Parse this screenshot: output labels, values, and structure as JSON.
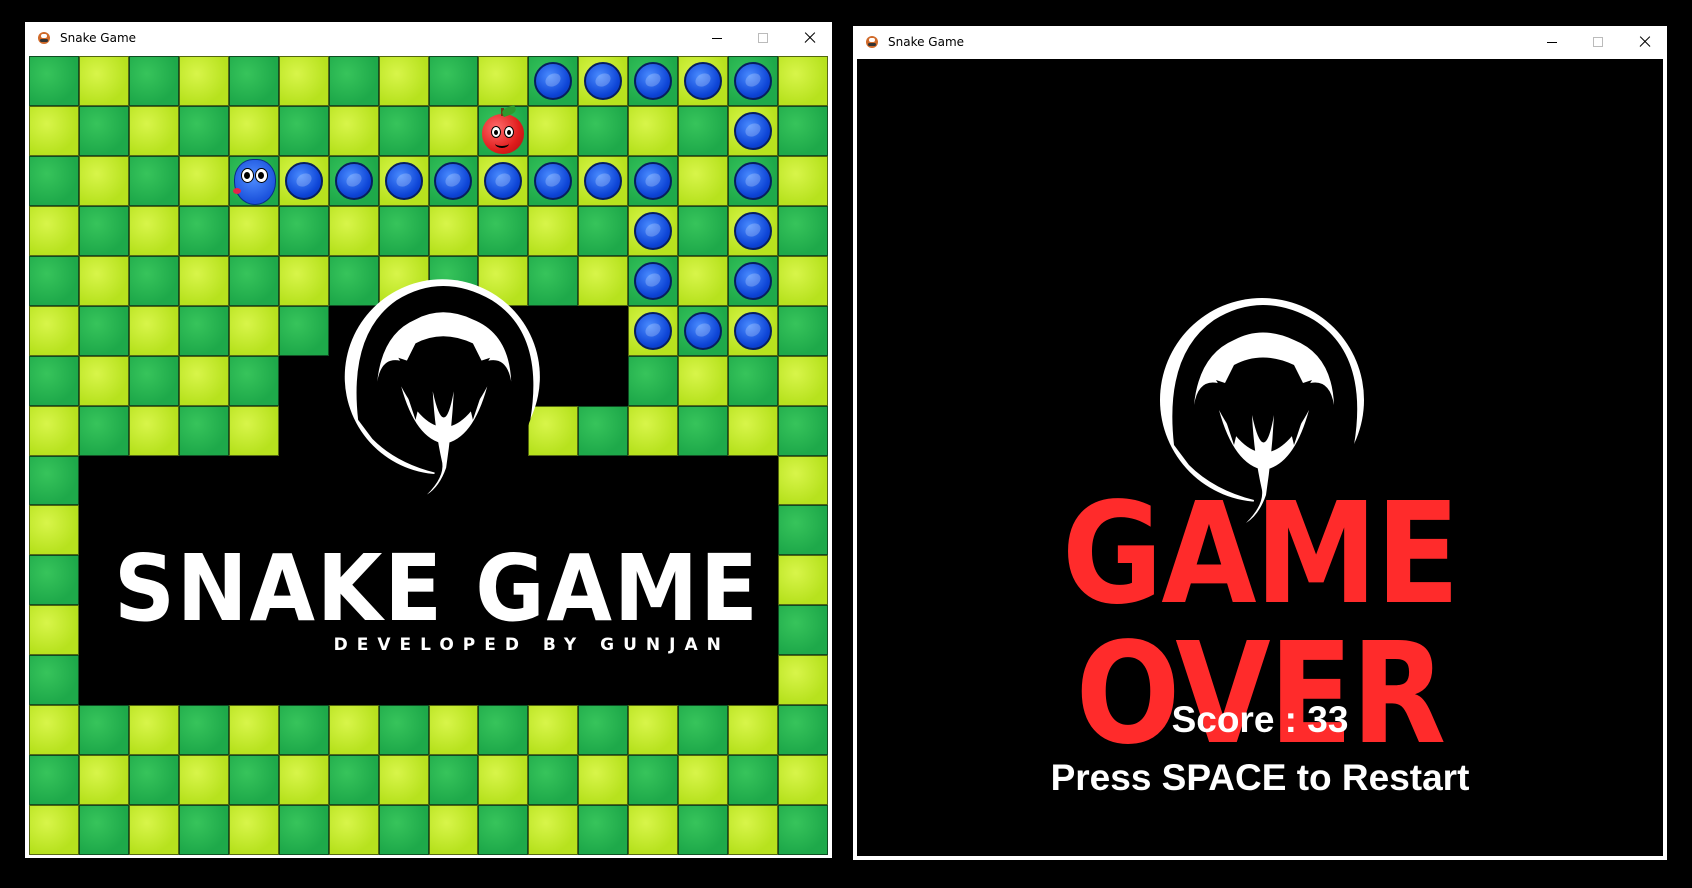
{
  "left_window": {
    "title": "Snake Game",
    "icon": "snake-app-icon"
  },
  "right_window": {
    "title": "Snake Game",
    "icon": "snake-app-icon"
  },
  "board": {
    "grid_cols": 16,
    "grid_rows": 16,
    "colors": {
      "dark_cell": "#22b04e",
      "light_cell": "#c6ec2a",
      "snake": "#1a55e0",
      "apple": "#e51d1d",
      "logo_bg": "#000000"
    },
    "snake_head": {
      "col": 4,
      "row": 2,
      "direction": "left"
    },
    "snake_body": [
      [
        5,
        2
      ],
      [
        6,
        2
      ],
      [
        7,
        2
      ],
      [
        8,
        2
      ],
      [
        9,
        2
      ],
      [
        10,
        2
      ],
      [
        11,
        2
      ],
      [
        12,
        2
      ],
      [
        12,
        3
      ],
      [
        12,
        4
      ],
      [
        12,
        5
      ],
      [
        13,
        5
      ],
      [
        14,
        5
      ],
      [
        14,
        4
      ],
      [
        14,
        3
      ],
      [
        14,
        2
      ],
      [
        14,
        1
      ],
      [
        14,
        0
      ],
      [
        13,
        0
      ],
      [
        12,
        0
      ],
      [
        11,
        0
      ],
      [
        10,
        0
      ]
    ],
    "apple": {
      "col": 9,
      "row": 1
    }
  },
  "logo": {
    "title": "SNAKE GAME",
    "subtitle": "DEVELOPED BY GUNJAN",
    "emblem": "cobra-emblem-icon"
  },
  "game_over": {
    "title": "GAME OVER",
    "score_text": "Score : 33",
    "restart_text": "Press SPACE to Restart",
    "title_color": "#ff2b2b",
    "emblem": "cobra-emblem-icon"
  }
}
